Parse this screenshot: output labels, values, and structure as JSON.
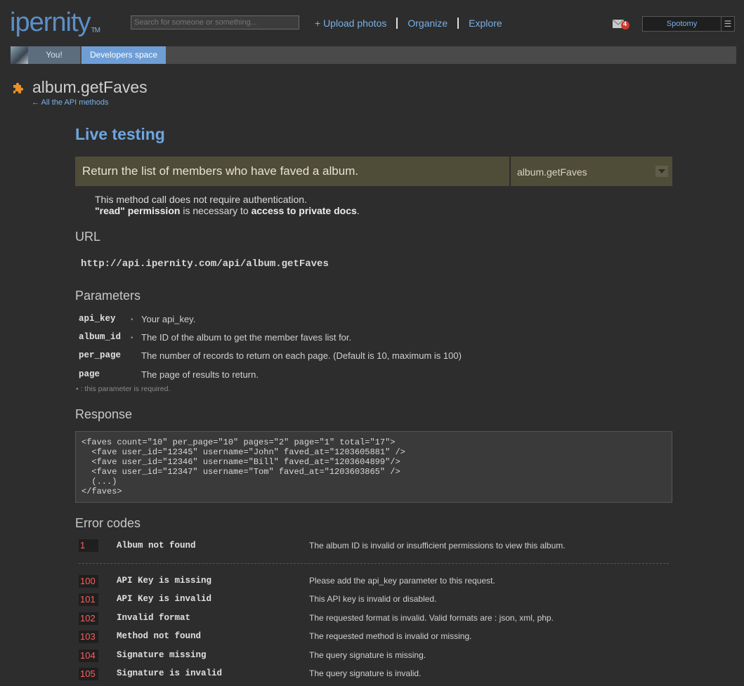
{
  "header": {
    "logo": "ipernity",
    "logo_tm": "TM",
    "search_placeholder": "Search for someone or something...",
    "nav": [
      "+ Upload photos",
      "Organize",
      "Explore"
    ],
    "mail_count": "4",
    "username": "Spotomy",
    "menu_glyph": "☰"
  },
  "tabs": {
    "you": "You!",
    "developers": "Developers space"
  },
  "page": {
    "title": "album.getFaves",
    "back_link": "← All the API methods",
    "live_testing": "Live testing",
    "description": "Return the list of members who have faved a album.",
    "method_select": "album.getFaves",
    "auth_line1": "This method call does not require authentication.",
    "auth_read": "\"read\" permission",
    "auth_mid": " is necessary to ",
    "auth_access": "access to private docs",
    "auth_end": "."
  },
  "url_section": {
    "heading": "URL",
    "url": "http://api.ipernity.com/api/album.getFaves"
  },
  "parameters": {
    "heading": "Parameters",
    "items": [
      {
        "name": "api_key",
        "required": "•",
        "desc": "Your api_key."
      },
      {
        "name": "album_id",
        "required": "•",
        "desc": "The ID of the album to get the member faves list for."
      },
      {
        "name": "per_page",
        "required": "",
        "desc": "The number of records to return on each page. (Default is 10, maximum is 100)"
      },
      {
        "name": "page",
        "required": "",
        "desc": "The page of results to return."
      }
    ],
    "required_note": "• : this parameter is required."
  },
  "response": {
    "heading": "Response",
    "code": "<faves count=\"10\" per_page=\"10\" pages=\"2\" page=\"1\" total=\"17\">\n  <fave user_id=\"12345\" username=\"John\" faved_at=\"1203605881\" />\n  <fave user_id=\"12346\" username=\"Bill\" faved_at=\"1203604899\"/>\n  <fave user_id=\"12347\" username=\"Tom\" faved_at=\"1203603865\" />\n  (...)\n</faves>"
  },
  "errors": {
    "heading": "Error codes",
    "items": [
      {
        "code": "1",
        "name": "Album not found",
        "desc": "The album ID is invalid or insufficient permissions to view this album."
      },
      {
        "code": "100",
        "name": "API Key is missing",
        "desc": "Please add the api_key parameter to this request."
      },
      {
        "code": "101",
        "name": "API Key is invalid",
        "desc": "This API key is invalid or disabled."
      },
      {
        "code": "102",
        "name": "Invalid format",
        "desc": "The requested format is invalid. Valid formats are : json, xml, php."
      },
      {
        "code": "103",
        "name": "Method not found",
        "desc": "The requested method is invalid or missing."
      },
      {
        "code": "104",
        "name": "Signature missing",
        "desc": "The query signature is missing."
      },
      {
        "code": "105",
        "name": "Signature is invalid",
        "desc": "The query signature is invalid."
      }
    ]
  }
}
